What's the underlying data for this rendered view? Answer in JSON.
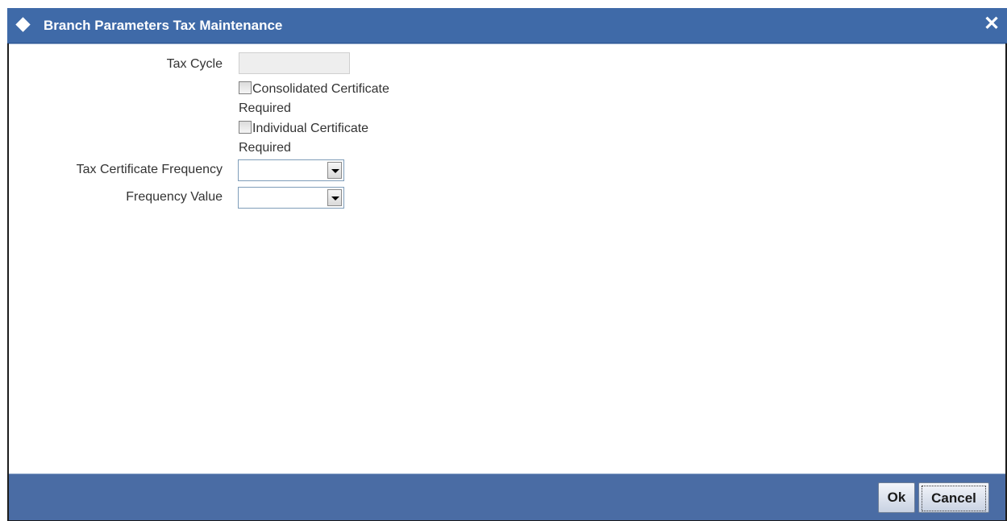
{
  "dialog": {
    "title": "Branch Parameters Tax Maintenance",
    "close_glyph": "✕"
  },
  "form": {
    "tax_cycle_label": "Tax Cycle",
    "tax_cycle_value": "",
    "consolidated_line1": "Consolidated Certificate",
    "consolidated_line2": "Required",
    "consolidated_checked": false,
    "individual_line1": "Individual Certificate",
    "individual_line2": "Required",
    "individual_checked": false,
    "tax_cert_freq_label": "Tax Certificate Frequency",
    "tax_cert_freq_value": "",
    "freq_value_label": "Frequency Value",
    "freq_value_value": ""
  },
  "footer": {
    "ok_label": "Ok",
    "cancel_label": "Cancel"
  },
  "colors": {
    "titlebar": "#3f6aa8",
    "footer": "#4a6ca4"
  },
  "icons": {
    "title": "diamond-icon",
    "close": "close-icon"
  }
}
